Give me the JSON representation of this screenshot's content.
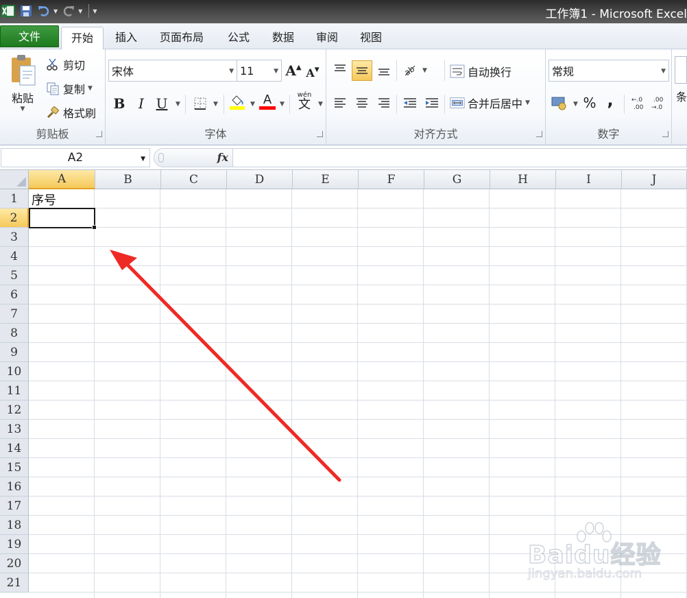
{
  "window": {
    "title": "工作簿1 - Microsoft Excel",
    "quick_access": [
      "save-icon",
      "undo-icon",
      "redo-icon"
    ]
  },
  "tabs": [
    {
      "label": "文件",
      "type": "file"
    },
    {
      "label": "开始",
      "active": true
    },
    {
      "label": "插入"
    },
    {
      "label": "页面布局"
    },
    {
      "label": "公式"
    },
    {
      "label": "数据"
    },
    {
      "label": "审阅"
    },
    {
      "label": "视图"
    }
  ],
  "ribbon": {
    "clipboard": {
      "paste_label": "粘贴",
      "cut_label": "剪切",
      "copy_label": "复制",
      "format_painter_label": "格式刷",
      "group_label": "剪贴板"
    },
    "font": {
      "font_name": "宋体",
      "font_size": "11",
      "bold": "B",
      "italic": "I",
      "underline": "U",
      "phonetic": "wén",
      "group_label": "字体",
      "highlight_color": "#ffff00",
      "font_color": "#ff0000"
    },
    "alignment": {
      "wrap_text_label": "自动换行",
      "merge_center_label": "合并后居中",
      "group_label": "对齐方式"
    },
    "number": {
      "format": "常规",
      "percent": "%",
      "comma": ",",
      "group_label": "数字"
    },
    "styles_partial": "条"
  },
  "formula_bar": {
    "name_box": "A2",
    "fx_label": "fx",
    "content": ""
  },
  "sheet": {
    "columns": [
      "A",
      "B",
      "C",
      "D",
      "E",
      "F",
      "G",
      "H",
      "I",
      "J"
    ],
    "rows": [
      "1",
      "2",
      "3",
      "4",
      "5",
      "6",
      "7",
      "8",
      "9",
      "10",
      "11",
      "12",
      "13",
      "14",
      "15",
      "16",
      "17",
      "18",
      "19",
      "20",
      "21"
    ],
    "selected_cell": "A2",
    "cells": {
      "A1": "序号"
    }
  },
  "annotation": {
    "color": "#ee2a24"
  },
  "watermark": {
    "main": "Baidu经验",
    "sub": "jingyan.baidu.com"
  }
}
